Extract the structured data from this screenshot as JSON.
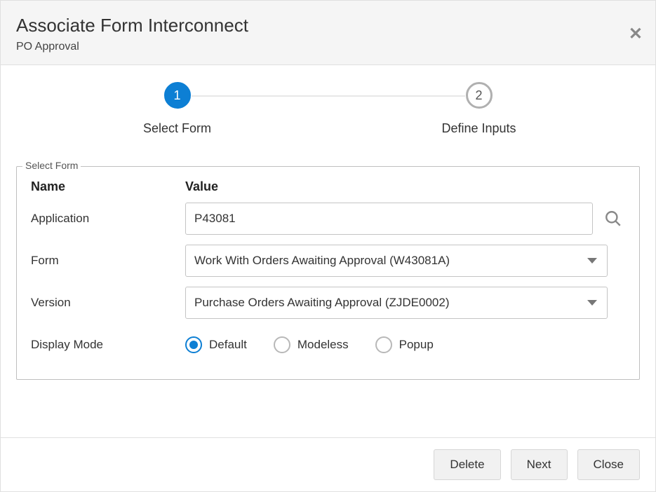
{
  "header": {
    "title": "Associate Form Interconnect",
    "subtitle": "PO Approval"
  },
  "stepper": {
    "step1_number": "1",
    "step1_label": "Select Form",
    "step2_number": "2",
    "step2_label": "Define Inputs"
  },
  "fieldset": {
    "legend": "Select Form",
    "header_name": "Name",
    "header_value": "Value",
    "rows": {
      "application": {
        "label": "Application",
        "value": "P43081"
      },
      "form": {
        "label": "Form",
        "value": "Work With Orders Awaiting Approval (W43081A)"
      },
      "version": {
        "label": "Version",
        "value": "Purchase Orders Awaiting Approval (ZJDE0002)"
      },
      "display_mode": {
        "label": "Display Mode",
        "options": {
          "default": "Default",
          "modeless": "Modeless",
          "popup": "Popup"
        },
        "selected": "default"
      }
    }
  },
  "footer": {
    "delete": "Delete",
    "next": "Next",
    "close": "Close"
  }
}
